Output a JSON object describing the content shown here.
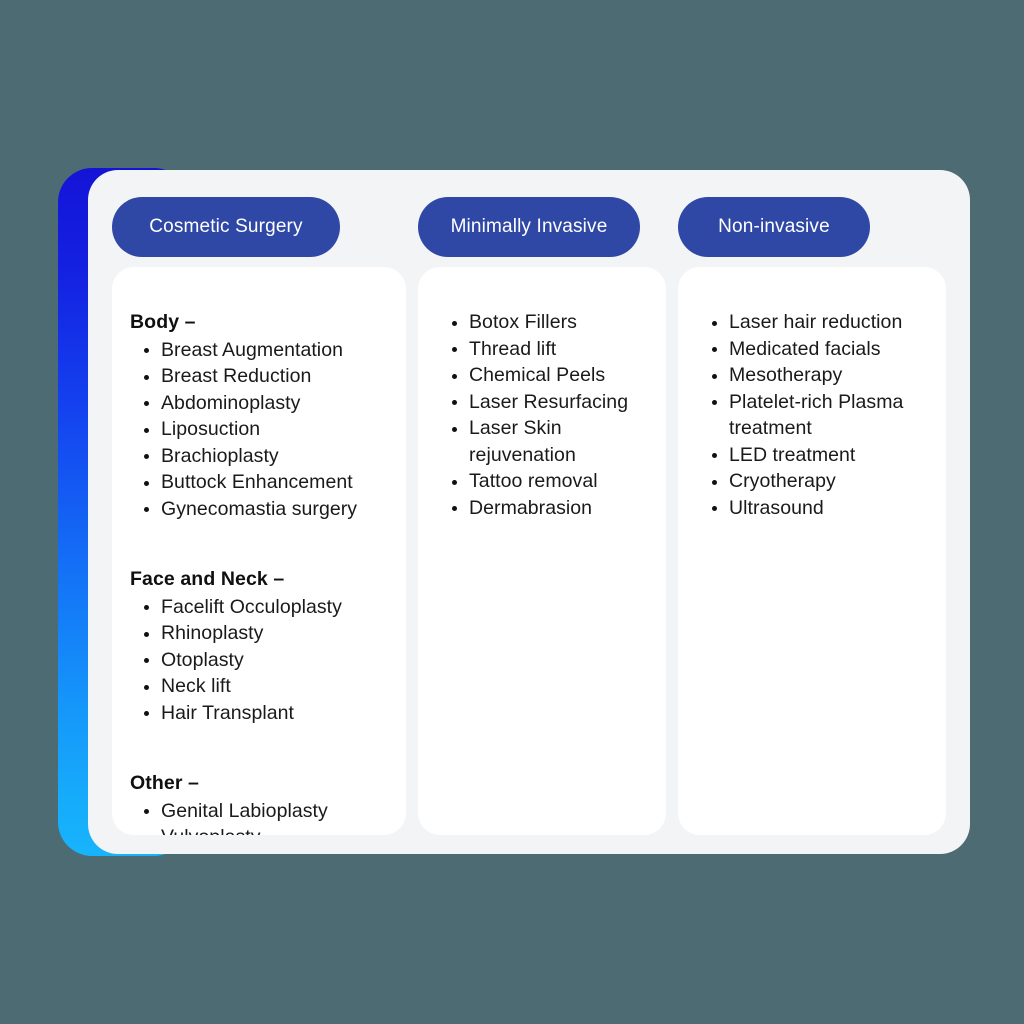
{
  "theme": {
    "background_color": "#4c6b72",
    "card_color": "#f3f4f6",
    "panel_color": "#ffffff",
    "pill_color": "#3048a5",
    "pill_text_color": "#ffffff",
    "accent_gradient_from": "#1414d6",
    "accent_gradient_to": "#17b4fb",
    "text_color": "#1a1a1a"
  },
  "columns": [
    {
      "header": "Cosmetic Surgery",
      "groups": [
        {
          "title": "Body –",
          "items": [
            "Breast Augmentation",
            "Breast Reduction",
            "Abdominoplasty",
            "Liposuction",
            "Brachioplasty",
            "Buttock Enhancement",
            "Gynecomastia surgery"
          ]
        },
        {
          "title": "Face and Neck –",
          "items": [
            "Facelift Occuloplasty",
            "Rhinoplasty",
            "Otoplasty",
            "Neck lift",
            "Hair Transplant"
          ]
        },
        {
          "title": "Other –",
          "items": [
            "Genital Labioplasty",
            "Vulvoplasty"
          ]
        }
      ]
    },
    {
      "header": "Minimally Invasive",
      "groups": [
        {
          "title": "",
          "items": [
            "Botox Fillers",
            "Thread lift",
            "Chemical Peels",
            "Laser Resurfacing",
            "Laser Skin rejuvenation",
            "Tattoo removal",
            "Dermabrasion"
          ]
        }
      ]
    },
    {
      "header": "Non-invasive",
      "groups": [
        {
          "title": "",
          "items": [
            "Laser hair reduction",
            "Medicated facials",
            "Mesotherapy",
            "Platelet-rich Plasma treatment",
            "LED treatment",
            "Cryotherapy",
            "Ultrasound"
          ]
        }
      ]
    }
  ]
}
